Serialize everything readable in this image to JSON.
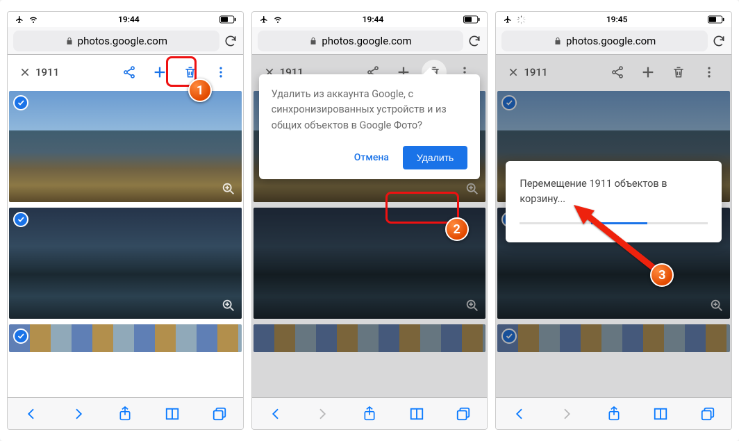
{
  "phones": [
    {
      "status": {
        "time": "19:44"
      },
      "url": "photos.google.com",
      "selection_count": "1911",
      "annot_badge": "1"
    },
    {
      "status": {
        "time": "19:44"
      },
      "url": "photos.google.com",
      "selection_count": "1911",
      "dialog": {
        "message": "Удалить из аккаунта Google, с синхронизированных устройств и из общих объектов в Google Фото?",
        "cancel_label": "Отмена",
        "confirm_label": "Удалить"
      },
      "annot_badge": "2"
    },
    {
      "status": {
        "time": "19:45"
      },
      "url": "photos.google.com",
      "selection_count": "1911",
      "progress": {
        "message": "Перемещение 1911 объектов в корзину..."
      },
      "annot_badge": "3"
    }
  ]
}
